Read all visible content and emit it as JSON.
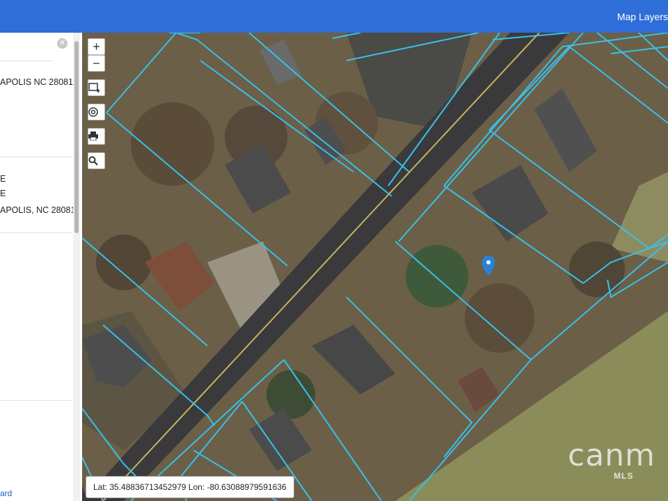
{
  "header": {
    "map_layers_label": "Map Layers"
  },
  "panel": {
    "close_glyph": "✕",
    "listing1": {
      "address_line": "APOLIS NC 28081"
    },
    "listing2": {
      "line1": "E",
      "line2": "E",
      "line3": "APOLIS, NC 28081"
    },
    "footer_link": "ard"
  },
  "map": {
    "controls": {
      "zoom_in": "+",
      "zoom_out": "−"
    },
    "coordinates": "Lat: 35.48836713452979 Lon: -80.63088979591636",
    "watermark": {
      "brand": "canm",
      "sub": "MLS"
    },
    "colors": {
      "parcel_line": "#37c1ec",
      "marker": "#2a82d8",
      "header": "#2f6ed8"
    }
  }
}
